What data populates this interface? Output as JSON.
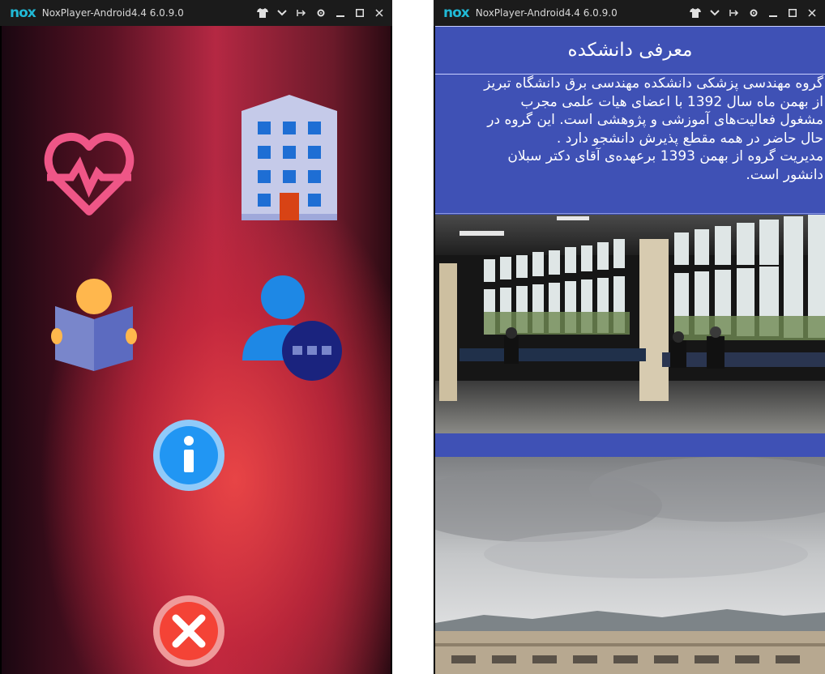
{
  "left_window": {
    "logo": "nox",
    "title": "NoxPlayer-Android4.4 6.0.9.0"
  },
  "right_window": {
    "logo": "nox",
    "title": "NoxPlayer-Android4.4 6.0.9.0"
  },
  "home": {
    "icons": [
      "heart-pulse-icon",
      "building-icon",
      "reader-icon",
      "user-more-icon",
      "info-icon",
      "close-icon"
    ]
  },
  "faculty_page": {
    "title": "معرفی دانشکده",
    "lines": [
      "گروه مهندسی پزشکی دانشکده مهندسی برق دانشگاه تبریز",
      "از بهمن ماه سال 1392 با اعضای هیات علمی مجرب",
      "مشغول فعالیت‌های آموزشی و پژوهشی است. این گروه در",
      "حال حاضر در همه مقطع  پذیرش دانشجو دارد .",
      "مدیریت  گروه از بهمن 1393 برعهده‌ی آقای دکتر سبلان",
      "دانشور است."
    ]
  },
  "colors": {
    "accent": "#3f51b5",
    "titlebar": "#1b1b1b",
    "logo": "#21b9d6"
  }
}
